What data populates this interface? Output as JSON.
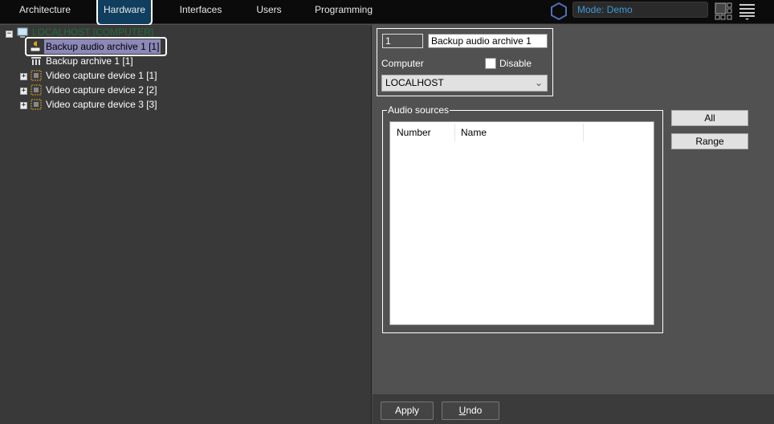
{
  "tabs": [
    {
      "label": "Architecture"
    },
    {
      "label": "Hardware"
    },
    {
      "label": "Interfaces"
    },
    {
      "label": "Users"
    },
    {
      "label": "Programming"
    }
  ],
  "mode": "Mode: Demo",
  "tree": {
    "root": "LOCALHOST [COMPUTER]",
    "items": [
      {
        "label": "Backup audio archive 1 [1]"
      },
      {
        "label": "Backup archive 1 [1]"
      },
      {
        "label": "Video capture device 1 [1]"
      },
      {
        "label": "Video capture device 2 [2]"
      },
      {
        "label": "Video capture device 3 [3]"
      }
    ]
  },
  "form": {
    "id": "1",
    "name": "Backup audio archive 1",
    "computer_label": "Computer",
    "disable_label": "Disable",
    "computer_value": "LOCALHOST",
    "audio_sources_label": "Audio sources",
    "columns": [
      "Number",
      "Name"
    ],
    "all_label": "All",
    "range_label": "Range"
  },
  "footer": {
    "apply": "Apply",
    "undo_u": "U",
    "undo_rest": "ndo"
  },
  "colors": {
    "accent": "#0f3e5e",
    "mode_text": "#3a9ad9",
    "selection": "#8c88b8"
  }
}
